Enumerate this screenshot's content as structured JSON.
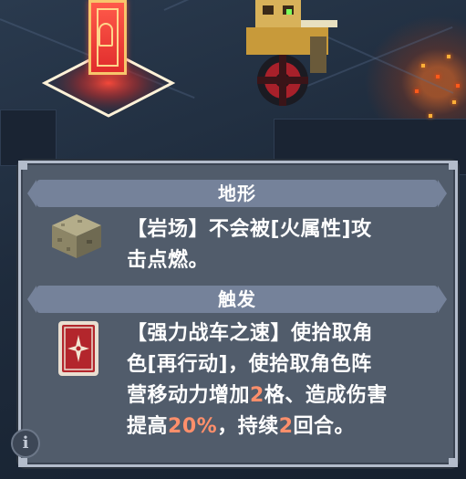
{
  "tooltip": {
    "terrain": {
      "header": "地形",
      "icon": "rock-block-icon",
      "line1": "【岩场】不会被[火属性]攻",
      "line2": "击点燃。"
    },
    "trigger": {
      "header": "触发",
      "icon": "red-card-icon",
      "line1": "【强力战车之速】使拾取角",
      "line2": "色[再行动]，使拾取角色阵",
      "line3_a": "营移动力增加",
      "line3_b": "2",
      "line3_c": "格、造成伤害",
      "line4_a": "提高",
      "line4_b": "20%",
      "line4_c": "，持续",
      "line4_d": "2",
      "line4_e": "回合。"
    }
  },
  "info_button": {
    "label": "i"
  },
  "colors": {
    "panel_bg": "#515c6b",
    "panel_border": "#b3bccb",
    "header_bg": "#75829a",
    "highlight": "#ff8f6b",
    "text": "#ffffff"
  }
}
